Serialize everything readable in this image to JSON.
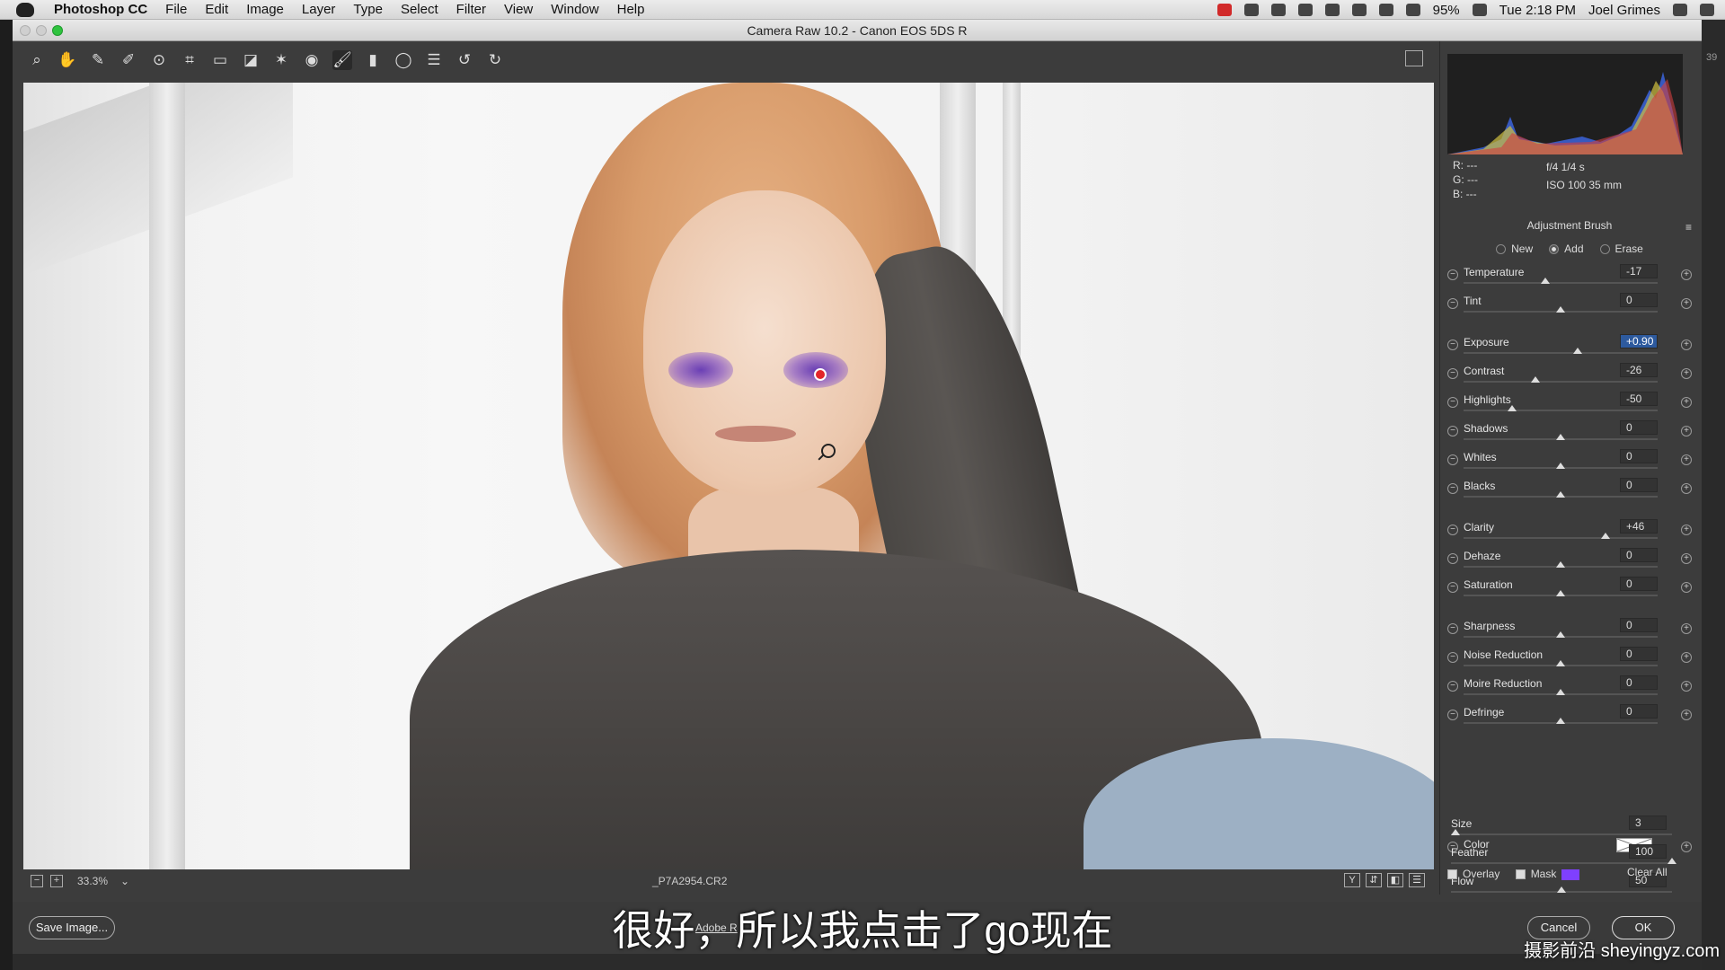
{
  "menubar": {
    "app": "Photoshop CC",
    "items": [
      "File",
      "Edit",
      "Image",
      "Layer",
      "Type",
      "Select",
      "Filter",
      "View",
      "Window",
      "Help"
    ],
    "battery": "95%",
    "clock": "Tue 2:18 PM",
    "user": "Joel Grimes"
  },
  "window": {
    "title": "Camera Raw 10.2  -  Canon EOS 5DS R"
  },
  "toolbar": {
    "tools": [
      {
        "name": "zoom-tool",
        "glyph": "⌕"
      },
      {
        "name": "hand-tool",
        "glyph": "✋"
      },
      {
        "name": "white-balance-tool",
        "glyph": "✎"
      },
      {
        "name": "color-sampler-tool",
        "glyph": "✐"
      },
      {
        "name": "targeted-adjustment-tool",
        "glyph": "⊙"
      },
      {
        "name": "crop-tool",
        "glyph": "⌗"
      },
      {
        "name": "straighten-tool",
        "glyph": "▭"
      },
      {
        "name": "transform-tool",
        "glyph": "◪"
      },
      {
        "name": "spot-removal-tool",
        "glyph": "✶"
      },
      {
        "name": "red-eye-tool",
        "glyph": "◉"
      },
      {
        "name": "adjustment-brush-tool",
        "glyph": "🖌"
      },
      {
        "name": "graduated-filter-tool",
        "glyph": "▮"
      },
      {
        "name": "radial-filter-tool",
        "glyph": "◯"
      },
      {
        "name": "presets-tool",
        "glyph": "☰"
      },
      {
        "name": "rotate-left-tool",
        "glyph": "↺"
      },
      {
        "name": "rotate-right-tool",
        "glyph": "↻"
      }
    ]
  },
  "status_bar": {
    "zoom": "33.3%",
    "filename": "_P7A2954.CR2",
    "view_buttons": [
      "Y",
      "⇵",
      "◧",
      "☰"
    ]
  },
  "info": {
    "r": "R:   ---",
    "g": "G:   ---",
    "b": "B:   ---",
    "aperture_shutter": "f/4    1/4 s",
    "iso_focal": "ISO 100    35 mm"
  },
  "panel": {
    "title": "Adjustment Brush",
    "modes": [
      "New",
      "Add",
      "Erase"
    ],
    "selected_mode": "Add",
    "sliders": [
      {
        "label": "Temperature",
        "value": "-17",
        "level": 0.42
      },
      {
        "label": "Tint",
        "value": "0",
        "level": 0.5
      },
      {
        "label": "Exposure",
        "value": "+0.90",
        "level": 0.59,
        "selected": true
      },
      {
        "label": "Contrast",
        "value": "-26",
        "level": 0.37
      },
      {
        "label": "Highlights",
        "value": "-50",
        "level": 0.25
      },
      {
        "label": "Shadows",
        "value": "0",
        "level": 0.5
      },
      {
        "label": "Whites",
        "value": "0",
        "level": 0.5
      },
      {
        "label": "Blacks",
        "value": "0",
        "level": 0.5
      },
      {
        "label": "Clarity",
        "value": "+46",
        "level": 0.73
      },
      {
        "label": "Dehaze",
        "value": "0",
        "level": 0.5
      },
      {
        "label": "Saturation",
        "value": "0",
        "level": 0.5
      },
      {
        "label": "Sharpness",
        "value": "0",
        "level": 0.5
      },
      {
        "label": "Noise Reduction",
        "value": "0",
        "level": 0.5
      },
      {
        "label": "Moire Reduction",
        "value": "0",
        "level": 0.5
      },
      {
        "label": "Defringe",
        "value": "0",
        "level": 0.5
      }
    ],
    "color_label": "Color",
    "brush": [
      {
        "label": "Size",
        "value": "3",
        "level": 0.02
      },
      {
        "label": "Feather",
        "value": "100",
        "level": 1.0
      },
      {
        "label": "Flow",
        "value": "50",
        "level": 0.5
      }
    ],
    "overlay_label": "Overlay",
    "mask_label": "Mask",
    "mask_color": "#7f40ff",
    "clear_all": "Clear All"
  },
  "footer": {
    "save_image": "Save Image...",
    "link_text": "Adobe R",
    "cancel": "Cancel",
    "ok": "OK"
  },
  "overlay": {
    "subtitle": "很好，所以我点击了go现在",
    "watermark": "摄影前沿 sheyingyz.com",
    "right_strip_number": "39"
  }
}
